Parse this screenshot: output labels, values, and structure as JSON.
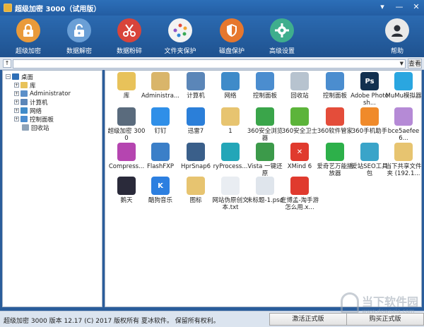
{
  "window": {
    "title": "超级加密 3000（试用版）",
    "controls": [
      "▾",
      "—",
      "✕"
    ]
  },
  "toolbar": {
    "items": [
      {
        "label": "超级加密",
        "icon": "lock-icon",
        "color": "#e99a3a"
      },
      {
        "label": "数据解密",
        "icon": "unlock-icon",
        "color": "#6a9fd6"
      },
      {
        "label": "数据粉碎",
        "icon": "scissors-icon",
        "color": "#d8443b"
      },
      {
        "label": "文件夹保护",
        "icon": "folder-wheel-icon",
        "color": "#f3f3f3"
      },
      {
        "label": "磁盘保护",
        "icon": "shield-icon",
        "color": "#e6772e"
      },
      {
        "label": "高级设置",
        "icon": "gear-icon",
        "color": "#3fae8d"
      },
      {
        "label": "帮助",
        "icon": "user-help-icon",
        "color": "#e9e9e9"
      }
    ]
  },
  "address": {
    "indicator": "↑",
    "value": "",
    "go_label": "查看",
    "dropdown": "▼"
  },
  "tree": {
    "items": [
      {
        "label": "桌面",
        "icon": "desktop-icon",
        "expander": "−",
        "color": "#2f6fb6"
      },
      {
        "label": "库",
        "icon": "library-icon",
        "expander": "+",
        "color": "#e8c25a"
      },
      {
        "label": "Administrator",
        "icon": "user-icon",
        "expander": "+",
        "color": "#5a8fc9"
      },
      {
        "label": "计算机",
        "icon": "computer-icon",
        "expander": "+",
        "color": "#5b86b8"
      },
      {
        "label": "网络",
        "icon": "network-icon",
        "expander": "+",
        "color": "#3f8bc9"
      },
      {
        "label": "控制面板",
        "icon": "control-panel-icon",
        "expander": "+",
        "color": "#4b8dcf"
      },
      {
        "label": "回收站",
        "icon": "recycle-bin-icon",
        "expander": "",
        "color": "#8ea3b8"
      }
    ]
  },
  "files": [
    {
      "label": "库",
      "icon": "library-icon",
      "color": "#e8c25a"
    },
    {
      "label": "Administra...",
      "icon": "user-folder-icon",
      "color": "#d9b56a"
    },
    {
      "label": "计算机",
      "icon": "computer-icon",
      "color": "#5b86b8"
    },
    {
      "label": "网络",
      "icon": "network-globe-icon",
      "color": "#3f8bc9"
    },
    {
      "label": "控制面板",
      "icon": "control-panel-icon",
      "color": "#4b8dcf"
    },
    {
      "label": "回收站",
      "icon": "recycle-bin-icon",
      "color": "#b7c3cf"
    },
    {
      "label": "控制面板",
      "icon": "control-panel-icon",
      "color": "#4b8dcf"
    },
    {
      "label": "Adobe Photosh...",
      "icon": "photoshop-icon",
      "color": "#12304f",
      "glyph": "Ps"
    },
    {
      "label": "MuMu模拟器",
      "icon": "mumu-icon",
      "color": "#2aa6e0"
    },
    {
      "label": "超级加密 3000",
      "icon": "super-encrypt-icon",
      "color": "#5a6b7d"
    },
    {
      "label": "钉钉",
      "icon": "dingtalk-icon",
      "color": "#2f8fe8"
    },
    {
      "label": "迅雷7",
      "icon": "thunder-icon",
      "color": "#2b7fd9"
    },
    {
      "label": "1",
      "icon": "folder-icon",
      "color": "#e7c470"
    },
    {
      "label": "360安全浏览器",
      "icon": "360-browser-icon",
      "color": "#3aa54a"
    },
    {
      "label": "360安全卫士",
      "icon": "360-guard-icon",
      "color": "#5cb43a"
    },
    {
      "label": "360软件管家",
      "icon": "360-software-icon",
      "color": "#e44d3a"
    },
    {
      "label": "360手机助手",
      "icon": "360-phone-icon",
      "color": "#f08a2a"
    },
    {
      "label": "bce5aefee6...",
      "icon": "image-file-icon",
      "color": "#b58ad6"
    },
    {
      "label": "Compress...",
      "icon": "compress-icon",
      "color": "#b545b0"
    },
    {
      "label": "FlashFXP",
      "icon": "flashfxp-icon",
      "color": "#3b7fc8"
    },
    {
      "label": "HprSnap6",
      "icon": "hypersnap-icon",
      "color": "#3a5f8a"
    },
    {
      "label": "ryProcess...",
      "icon": "process-icon",
      "color": "#23a6b8"
    },
    {
      "label": "Vista 一键还原",
      "icon": "vista-restore-icon",
      "color": "#3c9a4a"
    },
    {
      "label": "XMind 6",
      "icon": "xmind-icon",
      "color": "#e03a2e",
      "glyph": "✕"
    },
    {
      "label": "爱奇艺万能播放器",
      "icon": "iqiyi-player-icon",
      "color": "#2db04a"
    },
    {
      "label": "爱站SEO工具包",
      "icon": "seo-tool-icon",
      "color": "#3aa4c9"
    },
    {
      "label": "当下共享文件夹 (192.1...",
      "icon": "shared-folder-icon",
      "color": "#e7c470"
    },
    {
      "label": "鹅天",
      "icon": "game-icon",
      "color": "#2a2a3a"
    },
    {
      "label": "酷狗音乐",
      "icon": "kugou-icon",
      "color": "#2c7fe0",
      "glyph": "K"
    },
    {
      "label": "图标",
      "icon": "folder-icon",
      "color": "#e7c470"
    },
    {
      "label": "网站伪原创文本.txt",
      "icon": "text-file-icon",
      "color": "#e9edf2"
    },
    {
      "label": "未标题-1.psd",
      "icon": "psd-file-icon",
      "color": "#dfe5ec"
    },
    {
      "label": "庄博孟-淘手游怎么用.x...",
      "icon": "xmind-file-icon",
      "color": "#e03a2e"
    }
  ],
  "status": {
    "text": "超级加密 3000  版本 12.17 (C) 2017 版权所有 夏冰软件。 保留所有权利。",
    "activate_label": "激活正式版",
    "buy_label": "购买正式版"
  },
  "watermark": {
    "main": "当下软件园",
    "sub": "www.downxia.com"
  }
}
